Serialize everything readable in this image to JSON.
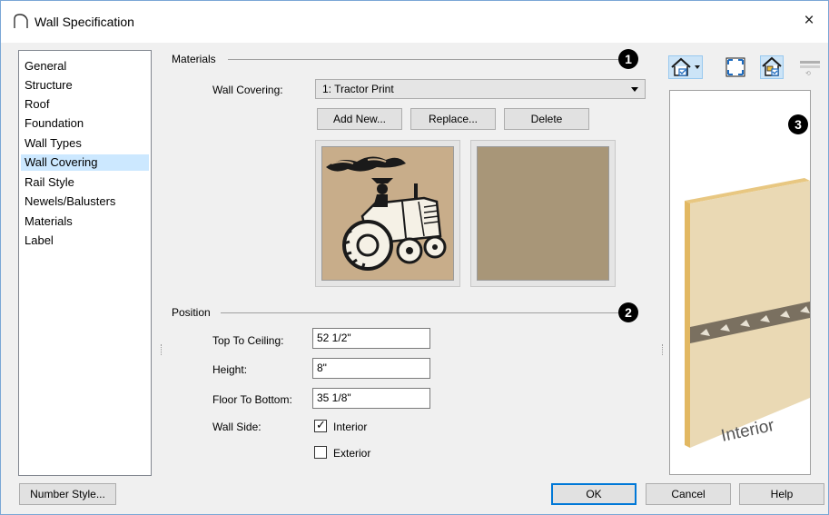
{
  "window": {
    "title": "Wall Specification",
    "close_glyph": "×"
  },
  "nav": {
    "items": [
      {
        "label": "General",
        "selected": false
      },
      {
        "label": "Structure",
        "selected": false
      },
      {
        "label": "Roof",
        "selected": false
      },
      {
        "label": "Foundation",
        "selected": false
      },
      {
        "label": "Wall Types",
        "selected": false
      },
      {
        "label": "Wall Covering",
        "selected": true
      },
      {
        "label": "Rail Style",
        "selected": false
      },
      {
        "label": "Newels/Balusters",
        "selected": false
      },
      {
        "label": "Materials",
        "selected": false
      },
      {
        "label": "Label",
        "selected": false
      }
    ]
  },
  "materials": {
    "heading": "Materials",
    "badge": "1",
    "wall_covering_label": "Wall Covering:",
    "wall_covering_value": "1:  Tractor Print",
    "add_new": "Add New...",
    "replace": "Replace...",
    "delete": "Delete"
  },
  "position": {
    "heading": "Position",
    "badge": "2",
    "top_to_ceiling_label": "Top To Ceiling:",
    "top_to_ceiling_value": "52 1/2\"",
    "height_label": "Height:",
    "height_value": "8\"",
    "floor_to_bottom_label": "Floor To Bottom:",
    "floor_to_bottom_value": "35 1/8\"",
    "wall_side_label": "Wall Side:",
    "interior_label": "Interior",
    "interior_checked": true,
    "exterior_label": "Exterior",
    "exterior_checked": false
  },
  "preview": {
    "badge": "3",
    "caption": "Interior"
  },
  "footer": {
    "number_style": "Number Style...",
    "ok": "OK",
    "cancel": "Cancel",
    "help": "Help"
  },
  "colors": {
    "selection": "#cce8ff",
    "swatch_tan": "#a89678",
    "tractor_bg": "#c8ad8a",
    "wall_face": "#ead9b4",
    "wall_edge": "#d9b56a",
    "accent_blue": "#0078d7"
  }
}
